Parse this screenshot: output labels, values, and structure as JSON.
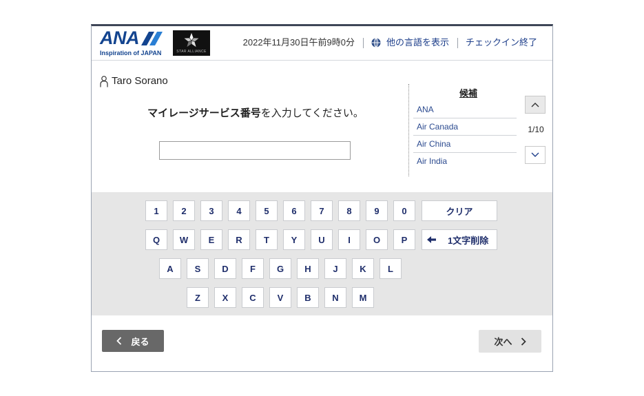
{
  "header": {
    "brand_logo": {
      "wordmark": "ANA",
      "tagline": "Inspiration of JAPAN"
    },
    "alliance_logo": {
      "wordmark": "STAR ALLIANCE"
    },
    "datetime": "2022年11月30日午前9時0分",
    "language_link": {
      "label": "他の言語を表示",
      "icon": "globe-icon"
    },
    "end_checkin_link": {
      "label": "チェックイン終了"
    }
  },
  "passenger": {
    "name": "Taro Sorano",
    "icon": "person-icon"
  },
  "prompt": {
    "emphasis": "マイレージサービス番号",
    "text": "を入力してください。"
  },
  "mileage_number_input": {
    "value": ""
  },
  "candidates": {
    "heading": "候補",
    "items": [
      "ANA",
      "Air Canada",
      "Air China",
      "Air India"
    ],
    "page_indicator": "1/10",
    "prev_page_icon": "chevron-up-icon",
    "next_page_icon": "chevron-down-icon"
  },
  "keyboard": {
    "rows": [
      [
        "1",
        "2",
        "3",
        "4",
        "5",
        "6",
        "7",
        "8",
        "9",
        "0"
      ],
      [
        "Q",
        "W",
        "E",
        "R",
        "T",
        "Y",
        "U",
        "I",
        "O",
        "P"
      ],
      [
        "A",
        "S",
        "D",
        "F",
        "G",
        "H",
        "J",
        "K",
        "L"
      ],
      [
        "Z",
        "X",
        "C",
        "V",
        "B",
        "N",
        "M"
      ]
    ],
    "clear_label": "クリア",
    "backspace_label": "1文字削除",
    "backspace_icon": "arrow-left-icon"
  },
  "footer": {
    "back_button": {
      "label": "戻る",
      "icon": "chevron-left-icon"
    },
    "next_button": {
      "label": "次へ",
      "icon": "chevron-right-icon"
    }
  },
  "colors": {
    "brand_navy": "#13448f",
    "link_blue": "#1d3e8a",
    "candidate_blue": "#2b4a8f",
    "key_label": "#1f2e6b",
    "keyboard_background": "#e6e6e6",
    "back_button": "#686868",
    "next_button": "#e2e2e2",
    "frame_top_border": "#3e4657"
  }
}
